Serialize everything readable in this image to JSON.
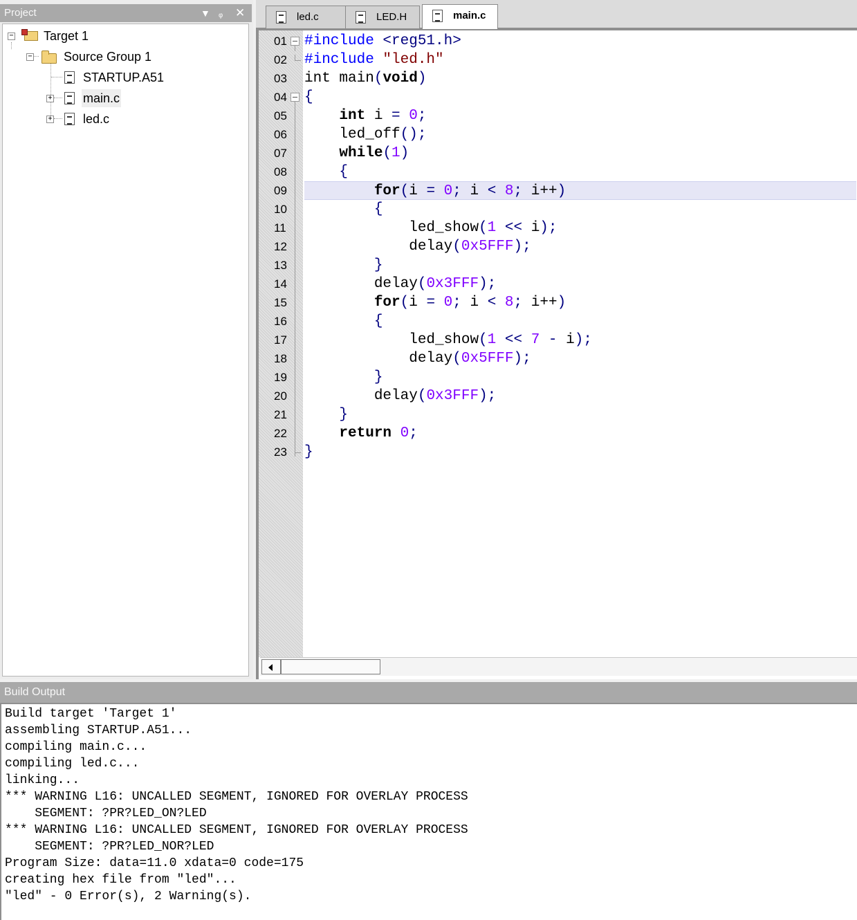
{
  "project_panel": {
    "title": "Project",
    "tree": {
      "target": "Target 1",
      "group": "Source Group 1",
      "files": [
        "STARTUP.A51",
        "main.c",
        "led.c"
      ]
    }
  },
  "editor": {
    "tabs": [
      {
        "label": "led.c",
        "active": false
      },
      {
        "label": "LED.H",
        "active": false
      },
      {
        "label": "main.c",
        "active": true
      }
    ],
    "line_numbers": [
      "01",
      "02",
      "03",
      "04",
      "05",
      "06",
      "07",
      "08",
      "09",
      "10",
      "11",
      "12",
      "13",
      "14",
      "15",
      "16",
      "17",
      "18",
      "19",
      "20",
      "21",
      "22",
      "23"
    ],
    "highlighted_line": "09"
  },
  "build_output": {
    "title": "Build Output",
    "lines": [
      "Build target 'Target 1'",
      "assembling STARTUP.A51...",
      "compiling main.c...",
      "compiling led.c...",
      "linking...",
      "*** WARNING L16: UNCALLED SEGMENT, IGNORED FOR OVERLAY PROCESS",
      "    SEGMENT: ?PR?LED_ON?LED",
      "*** WARNING L16: UNCALLED SEGMENT, IGNORED FOR OVERLAY PROCESS",
      "    SEGMENT: ?PR?LED_NOR?LED",
      "Program Size: data=11.0 xdata=0 code=175",
      "creating hex file from \"led\"...",
      "\"led\" - 0 Error(s), 2 Warning(s)."
    ]
  },
  "code": [
    [
      {
        "t": "#include ",
        "c": "pp"
      },
      {
        "t": "<reg51.h>",
        "c": "sym"
      }
    ],
    [
      {
        "t": "#include ",
        "c": "pp"
      },
      {
        "t": "\"led.h\"",
        "c": "str"
      }
    ],
    [
      {
        "t": "int",
        "c": ""
      },
      {
        "t": " main",
        "c": ""
      },
      {
        "t": "(",
        "c": "sym"
      },
      {
        "t": "void",
        "c": "kw"
      },
      {
        "t": ")",
        "c": "sym"
      }
    ],
    [
      {
        "t": "{",
        "c": "sym"
      }
    ],
    [
      {
        "t": "    ",
        "c": ""
      },
      {
        "t": "int",
        "c": "kw"
      },
      {
        "t": " i ",
        "c": ""
      },
      {
        "t": "=",
        "c": "sym"
      },
      {
        "t": " 0",
        "c": "num"
      },
      {
        "t": ";",
        "c": "sym"
      }
    ],
    [
      {
        "t": "    led_off",
        "c": ""
      },
      {
        "t": "();",
        "c": "sym"
      }
    ],
    [
      {
        "t": "    ",
        "c": ""
      },
      {
        "t": "while",
        "c": "kw"
      },
      {
        "t": "(",
        "c": "sym"
      },
      {
        "t": "1",
        "c": "num"
      },
      {
        "t": ")",
        "c": "sym"
      }
    ],
    [
      {
        "t": "    ",
        "c": ""
      },
      {
        "t": "{",
        "c": "sym"
      }
    ],
    [
      {
        "t": "        ",
        "c": ""
      },
      {
        "t": "for",
        "c": "kw"
      },
      {
        "t": "(",
        "c": "sym"
      },
      {
        "t": "i ",
        "c": ""
      },
      {
        "t": "=",
        "c": "sym"
      },
      {
        "t": " 0",
        "c": "num"
      },
      {
        "t": ";",
        "c": "sym"
      },
      {
        "t": " i ",
        "c": ""
      },
      {
        "t": "<",
        "c": "sym"
      },
      {
        "t": " 8",
        "c": "num"
      },
      {
        "t": ";",
        "c": "sym"
      },
      {
        "t": " i++",
        "c": ""
      },
      {
        "t": ")",
        "c": "sym"
      }
    ],
    [
      {
        "t": "        ",
        "c": ""
      },
      {
        "t": "{",
        "c": "sym"
      }
    ],
    [
      {
        "t": "            led_show",
        "c": ""
      },
      {
        "t": "(",
        "c": "sym"
      },
      {
        "t": "1",
        "c": "num"
      },
      {
        "t": " << ",
        "c": "sym"
      },
      {
        "t": "i",
        "c": ""
      },
      {
        "t": ");",
        "c": "sym"
      }
    ],
    [
      {
        "t": "            delay",
        "c": ""
      },
      {
        "t": "(",
        "c": "sym"
      },
      {
        "t": "0x5FFF",
        "c": "num"
      },
      {
        "t": ");",
        "c": "sym"
      }
    ],
    [
      {
        "t": "        ",
        "c": ""
      },
      {
        "t": "}",
        "c": "sym"
      }
    ],
    [
      {
        "t": "        delay",
        "c": ""
      },
      {
        "t": "(",
        "c": "sym"
      },
      {
        "t": "0x3FFF",
        "c": "num"
      },
      {
        "t": ");",
        "c": "sym"
      }
    ],
    [
      {
        "t": "        ",
        "c": ""
      },
      {
        "t": "for",
        "c": "kw"
      },
      {
        "t": "(",
        "c": "sym"
      },
      {
        "t": "i ",
        "c": ""
      },
      {
        "t": "=",
        "c": "sym"
      },
      {
        "t": " 0",
        "c": "num"
      },
      {
        "t": ";",
        "c": "sym"
      },
      {
        "t": " i ",
        "c": ""
      },
      {
        "t": "<",
        "c": "sym"
      },
      {
        "t": " 8",
        "c": "num"
      },
      {
        "t": ";",
        "c": "sym"
      },
      {
        "t": " i++",
        "c": ""
      },
      {
        "t": ")",
        "c": "sym"
      }
    ],
    [
      {
        "t": "        ",
        "c": ""
      },
      {
        "t": "{",
        "c": "sym"
      }
    ],
    [
      {
        "t": "            led_show",
        "c": ""
      },
      {
        "t": "(",
        "c": "sym"
      },
      {
        "t": "1",
        "c": "num"
      },
      {
        "t": " << ",
        "c": "sym"
      },
      {
        "t": "7",
        "c": "num"
      },
      {
        "t": " - ",
        "c": "sym"
      },
      {
        "t": "i",
        "c": ""
      },
      {
        "t": ");",
        "c": "sym"
      }
    ],
    [
      {
        "t": "            delay",
        "c": ""
      },
      {
        "t": "(",
        "c": "sym"
      },
      {
        "t": "0x5FFF",
        "c": "num"
      },
      {
        "t": ");",
        "c": "sym"
      }
    ],
    [
      {
        "t": "        ",
        "c": ""
      },
      {
        "t": "}",
        "c": "sym"
      }
    ],
    [
      {
        "t": "        delay",
        "c": ""
      },
      {
        "t": "(",
        "c": "sym"
      },
      {
        "t": "0x3FFF",
        "c": "num"
      },
      {
        "t": ");",
        "c": "sym"
      }
    ],
    [
      {
        "t": "    ",
        "c": ""
      },
      {
        "t": "}",
        "c": "sym"
      }
    ],
    [
      {
        "t": "    ",
        "c": ""
      },
      {
        "t": "return",
        "c": "kw"
      },
      {
        "t": " 0",
        "c": "num"
      },
      {
        "t": ";",
        "c": "sym"
      }
    ],
    [
      {
        "t": "}",
        "c": "sym"
      }
    ]
  ]
}
